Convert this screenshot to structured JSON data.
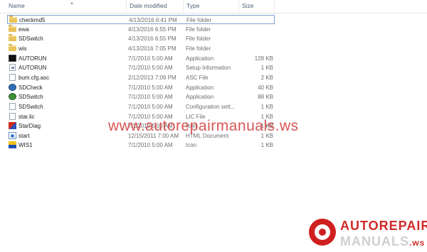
{
  "columns": {
    "name": "Name",
    "date": "Date modified",
    "type": "Type",
    "size": "Size"
  },
  "files": [
    {
      "name": "checkmd5",
      "date": "4/13/2016 6:41 PM",
      "type": "File folder",
      "size": "",
      "icon": "folder-icon",
      "selected": true
    },
    {
      "name": "ewa",
      "date": "4/13/2016 6:55 PM",
      "type": "File folder",
      "size": "",
      "icon": "folder-icon"
    },
    {
      "name": "SDSwitch",
      "date": "4/13/2016 6:55 PM",
      "type": "File folder",
      "size": "",
      "icon": "folder-icon"
    },
    {
      "name": "wis",
      "date": "4/13/2016 7:05 PM",
      "type": "File folder",
      "size": "",
      "icon": "folder-icon"
    },
    {
      "name": "AUTORUN",
      "date": "7/1/2010 5:00 AM",
      "type": "Application",
      "size": "128 KB",
      "icon": "application-icon"
    },
    {
      "name": "AUTORUN",
      "date": "7/1/2010 5:00 AM",
      "type": "Setup Information",
      "size": "1 KB",
      "icon": "setup-info-icon"
    },
    {
      "name": "bum.cfg.asc",
      "date": "2/12/2013 7:09 PM",
      "type": "ASC File",
      "size": "2 KB",
      "icon": "document-icon"
    },
    {
      "name": "SDCheck",
      "date": "7/1/2010 5:00 AM",
      "type": "Application",
      "size": "40 KB",
      "icon": "sdcheck-app-icon"
    },
    {
      "name": "SDSwitch",
      "date": "7/1/2010 5:00 AM",
      "type": "Application",
      "size": "88 KB",
      "icon": "sdswitch-app-icon"
    },
    {
      "name": "SDSwitch",
      "date": "7/1/2010 5:00 AM",
      "type": "Configuration sett...",
      "size": "1 KB",
      "icon": "config-settings-icon"
    },
    {
      "name": "star.lic",
      "date": "7/1/2010 5:00 AM",
      "type": "LIC File",
      "size": "1 KB",
      "icon": "document-icon"
    },
    {
      "name": "StarDiag",
      "date": "7/1/2010 5:00 AM",
      "type": "Icon",
      "size": "1 KB",
      "icon": "stardiag-icon"
    },
    {
      "name": "start",
      "date": "12/15/2011 7:00 AM",
      "type": "HTML Document",
      "size": "1 KB",
      "icon": "html-document-icon"
    },
    {
      "name": "WIS1",
      "date": "7/1/2010 5:00 AM",
      "type": "Icon",
      "size": "1 KB",
      "icon": "wis-icon"
    }
  ],
  "watermark": "www.autorepairmanuals.ws",
  "logo": {
    "line1": "AUTOREPAIR",
    "line2": "MANUALS",
    "tld": ".ws"
  },
  "colors": {
    "selection_border": "#7da2ce",
    "watermark": "#cd2626",
    "logo_red": "#cf1f1f"
  }
}
